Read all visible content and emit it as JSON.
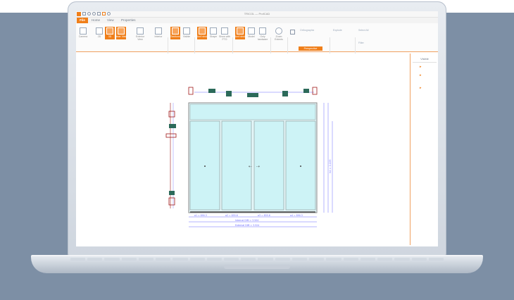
{
  "app": {
    "title": "TRICOL — ProfCAD"
  },
  "tabs": [
    {
      "label": "File",
      "active": true
    },
    {
      "label": "Home",
      "active": false
    },
    {
      "label": "View",
      "active": false
    },
    {
      "label": "Properties",
      "active": false
    }
  ],
  "ribbon": {
    "buttons": [
      {
        "label": "Camera",
        "active": false
      },
      {
        "label": "2D",
        "active": false
      },
      {
        "label": "3D",
        "active": true
      },
      {
        "label": "Inner View",
        "active": true
      },
      {
        "label": "Exterior View",
        "active": false
      },
      {
        "label": "Interior",
        "active": false
      },
      {
        "label": "Sections",
        "active": true
      },
      {
        "label": "Visible",
        "active": false
      },
      {
        "label": "Don't show",
        "active": true
      },
      {
        "label": "Shape",
        "active": false
      },
      {
        "label": "Show with FTO",
        "active": false
      },
      {
        "label": "Don't show",
        "active": true
      },
      {
        "label": "Model",
        "active": false
      },
      {
        "label": "Only hardware",
        "active": false
      },
      {
        "label": "Zoom Extents",
        "active": false
      }
    ],
    "groups": [
      "Edit Mode",
      "View Modes",
      "View",
      "Machinings",
      "Hardware",
      "Zoom",
      "Camera 3D",
      "Explode",
      "Selection"
    ],
    "small_items": {
      "ortho": "Orthographic",
      "perspective": "Perspective",
      "explode": "Explode",
      "select_all": "Select All",
      "filter": "Filter"
    }
  },
  "right_panel": {
    "tab": "Visible",
    "markers": [
      "▸",
      "▸",
      "▸"
    ]
  },
  "drawing": {
    "dim_bottom_1": "a1 = 890.3",
    "dim_bottom_2": "a2 = 855.6",
    "dim_bottom_3": "a3 = 855.6",
    "dim_bottom_4": "a4 = 890.3",
    "dim_total_1": "Internal DIM = 3.504",
    "dim_total_2": "External DIM = 3.524",
    "dim_right": "hd = 2.225",
    "colors": {
      "glass": "#cdf3f6",
      "frame": "#c8c8c8",
      "dim_line": "#6a6aff",
      "hardware": "#2c6a5a",
      "red": "#a01818"
    }
  }
}
